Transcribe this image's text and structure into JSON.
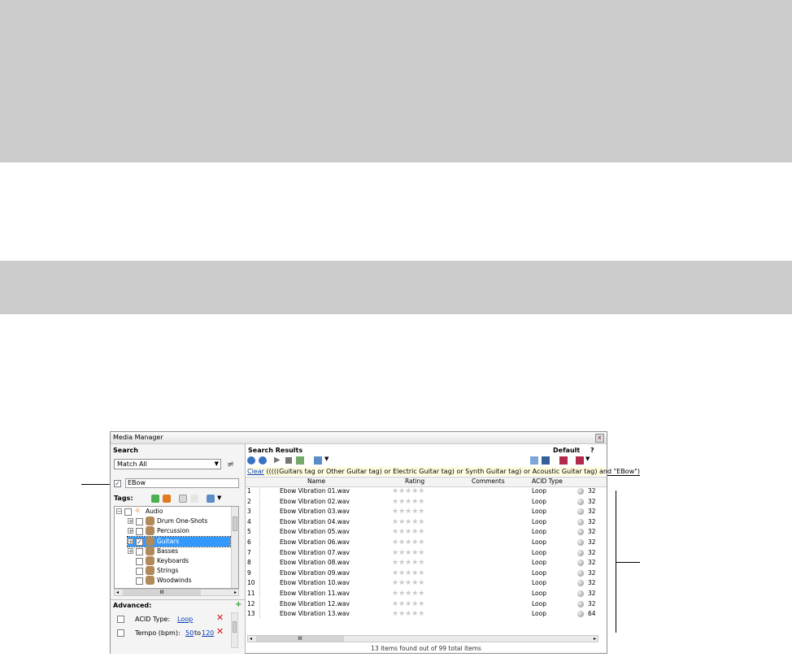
{
  "window": {
    "title": "Media Manager",
    "close_glyph": "x"
  },
  "search": {
    "header": "Search",
    "match_mode": "Match All",
    "keyword_checked": true,
    "keyword_value": "EBow",
    "tags_label": "Tags:",
    "tree": [
      {
        "label": "Audio",
        "level": 0,
        "icon": "audio-icon",
        "expander": "−",
        "selected": false,
        "checked": false
      },
      {
        "label": "Drum One-Shots",
        "level": 1,
        "icon": "drum-icon",
        "expander": "+",
        "selected": false,
        "checked": false
      },
      {
        "label": "Percussion",
        "level": 1,
        "icon": "percussion-icon",
        "expander": "+",
        "selected": false,
        "checked": false
      },
      {
        "label": "Guitars",
        "level": 1,
        "icon": "guitar-icon",
        "expander": "+",
        "selected": true,
        "checked": true
      },
      {
        "label": "Basses",
        "level": 1,
        "icon": "bass-icon",
        "expander": "+",
        "selected": false,
        "checked": false
      },
      {
        "label": "Keyboards",
        "level": 1,
        "icon": "keyboard-icon",
        "expander": "",
        "selected": false,
        "checked": false
      },
      {
        "label": "Strings",
        "level": 1,
        "icon": "strings-icon",
        "expander": "",
        "selected": false,
        "checked": false
      },
      {
        "label": "Woodwinds",
        "level": 1,
        "icon": "woodwinds-icon",
        "expander": "",
        "selected": false,
        "checked": false
      }
    ],
    "scroll_grip": "III",
    "advanced_label": "Advanced:",
    "advanced": {
      "acid_label": "ACID Type:",
      "acid_value": "Loop",
      "tempo_label": "Tempo (bpm):",
      "tempo_from": "50",
      "tempo_to_word": "to",
      "tempo_to": "120"
    }
  },
  "results": {
    "header": "Search Results",
    "view_name": "Default",
    "help": "?",
    "clear_label": "Clear",
    "query": "(((((Guitars tag or Other Guitar tag) or Electric Guitar tag) or Synth Guitar tag) or Acoustic Guitar tag) and \"EBow\")",
    "columns": {
      "name": "Name",
      "rating": "Rating",
      "comments": "Comments",
      "acid_type": "ACID Type"
    },
    "rows": [
      {
        "num": "1",
        "name": "Ebow Vibration 01.wav",
        "stars": "★★★★★",
        "acid": "Loop",
        "bpm": "32"
      },
      {
        "num": "2",
        "name": "Ebow Vibration 02.wav",
        "stars": "★★★★★",
        "acid": "Loop",
        "bpm": "32"
      },
      {
        "num": "3",
        "name": "Ebow Vibration 03.wav",
        "stars": "★★★★★",
        "acid": "Loop",
        "bpm": "32"
      },
      {
        "num": "4",
        "name": "Ebow Vibration 04.wav",
        "stars": "★★★★★",
        "acid": "Loop",
        "bpm": "32"
      },
      {
        "num": "5",
        "name": "Ebow Vibration 05.wav",
        "stars": "★★★★★",
        "acid": "Loop",
        "bpm": "32"
      },
      {
        "num": "6",
        "name": "Ebow Vibration 06.wav",
        "stars": "★★★★★",
        "acid": "Loop",
        "bpm": "32"
      },
      {
        "num": "7",
        "name": "Ebow Vibration 07.wav",
        "stars": "★★★★★",
        "acid": "Loop",
        "bpm": "32"
      },
      {
        "num": "8",
        "name": "Ebow Vibration 08.wav",
        "stars": "★★★★★",
        "acid": "Loop",
        "bpm": "32"
      },
      {
        "num": "9",
        "name": "Ebow Vibration 09.wav",
        "stars": "★★★★★",
        "acid": "Loop",
        "bpm": "32"
      },
      {
        "num": "10",
        "name": "Ebow Vibration 10.wav",
        "stars": "★★★★★",
        "acid": "Loop",
        "bpm": "32"
      },
      {
        "num": "11",
        "name": "Ebow Vibration 11.wav",
        "stars": "★★★★★",
        "acid": "Loop",
        "bpm": "32"
      },
      {
        "num": "12",
        "name": "Ebow Vibration 12.wav",
        "stars": "★★★★★",
        "acid": "Loop",
        "bpm": "32"
      },
      {
        "num": "13",
        "name": "Ebow Vibration 13.wav",
        "stars": "★★★★★",
        "acid": "Loop",
        "bpm": "64"
      }
    ],
    "scroll_grip": "III",
    "status": "13 items found out of 99 total items"
  },
  "colors": {
    "band_gray": "#cccccc",
    "selection": "#3399ff",
    "link": "#0b3dbd",
    "remove_x": "#d01010",
    "query_bg": "#fffde0"
  }
}
